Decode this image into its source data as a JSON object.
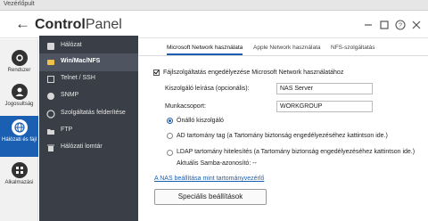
{
  "window": {
    "title": "Vezérlőpult"
  },
  "header": {
    "back_glyph": "←",
    "title_bold": "Control",
    "title_light": "Panel"
  },
  "left_nav": [
    {
      "label": "Rendszer",
      "icon": "gear-icon",
      "active": false
    },
    {
      "label": "Jogosultság",
      "icon": "user-icon",
      "active": false
    },
    {
      "label": "Hálózati és fájl",
      "icon": "globe-icon",
      "active": true
    },
    {
      "label": "Alkalmazási",
      "icon": "apps-icon",
      "active": false
    }
  ],
  "sidebar": {
    "items": [
      {
        "label": "Hálózat",
        "icon": "network-icon"
      },
      {
        "label": "Win/Mac/NFS",
        "icon": "folders-icon",
        "active": true
      },
      {
        "label": "Telnet / SSH",
        "icon": "terminal-icon"
      },
      {
        "label": "SNMP",
        "icon": "snmp-icon"
      },
      {
        "label": "Szolgáltatás felderítése",
        "icon": "discovery-icon"
      },
      {
        "label": "FTP",
        "icon": "ftp-icon"
      },
      {
        "label": "Hálózati lomtár",
        "icon": "trash-icon"
      }
    ]
  },
  "tabs": [
    {
      "label": "Microsoft Network használata",
      "active": true
    },
    {
      "label": "Apple Network használata"
    },
    {
      "label": "NFS-szolgáltatás"
    }
  ],
  "form": {
    "enable_label": "Fájlszolgáltatás engedélyezése Microsoft Network használatához",
    "server_desc_label": "Kiszolgáló leírása (opcionális):",
    "server_desc_value": "NAS Server",
    "workgroup_label": "Munkacsoport:",
    "workgroup_value": "WORKGROUP",
    "radio_standalone": "Önálló kiszolgáló",
    "radio_ad": "AD tartomány tag (a Tartomány biztonság engedélyezéséhez kattintson ide.)",
    "radio_ldap": "LDAP tartomány hitelesítés (a Tartomány biztonság engedélyezéséhez kattintson ide.)",
    "samba_id": "Aktuális Samba-azonosító: --",
    "domain_link": "A NAS beállítása mint tartományvezérlő",
    "advanced_button": "Speciális beállítások"
  },
  "colors": {
    "accent": "#1b5fb3",
    "sidebar_bg": "#3a3f47",
    "sidebar_active": "#4e5560"
  }
}
